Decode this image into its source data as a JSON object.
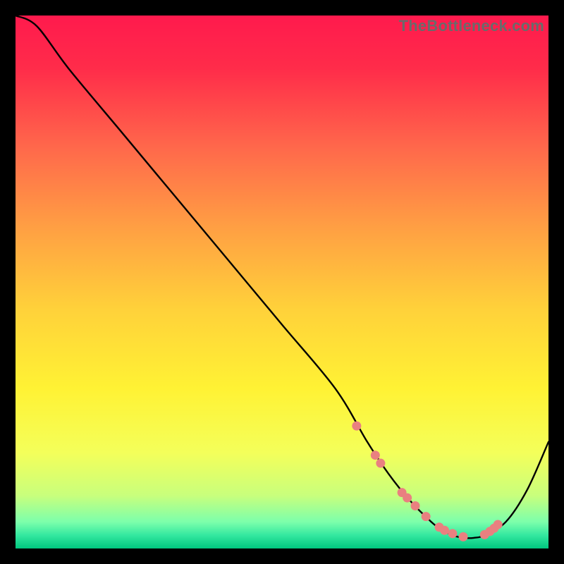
{
  "watermark": "TheBottleneck.com",
  "chart_data": {
    "type": "line",
    "title": "",
    "xlabel": "",
    "ylabel": "",
    "xlim": [
      0,
      100
    ],
    "ylim": [
      0,
      100
    ],
    "x": [
      0,
      4,
      10,
      20,
      30,
      40,
      50,
      60,
      66,
      70,
      74,
      78,
      80,
      82,
      84,
      86,
      88,
      92,
      96,
      100
    ],
    "y": [
      100,
      98,
      90,
      78,
      66,
      54,
      42,
      30,
      20,
      14,
      9,
      5,
      3.5,
      2.5,
      2,
      2,
      2.5,
      5,
      11,
      20
    ],
    "marker_points": {
      "x": [
        64,
        67.5,
        68.5,
        72.5,
        73.5,
        75,
        77,
        79.5,
        80.5,
        82,
        84,
        88,
        89,
        89.8,
        90.5
      ],
      "y": [
        23,
        17.5,
        16,
        10.5,
        9.5,
        8,
        6,
        4,
        3.4,
        2.8,
        2.2,
        2.6,
        3.2,
        3.8,
        4.5
      ]
    },
    "gradient_stops": [
      {
        "offset": 0.0,
        "color": "#ff1a4d"
      },
      {
        "offset": 0.1,
        "color": "#ff2c4a"
      },
      {
        "offset": 0.25,
        "color": "#ff694b"
      },
      {
        "offset": 0.4,
        "color": "#ffa043"
      },
      {
        "offset": 0.55,
        "color": "#ffd13a"
      },
      {
        "offset": 0.7,
        "color": "#fff234"
      },
      {
        "offset": 0.82,
        "color": "#f4ff5a"
      },
      {
        "offset": 0.9,
        "color": "#c9ff7c"
      },
      {
        "offset": 0.95,
        "color": "#7dffab"
      },
      {
        "offset": 0.975,
        "color": "#34e8a0"
      },
      {
        "offset": 1.0,
        "color": "#00c77f"
      }
    ]
  }
}
